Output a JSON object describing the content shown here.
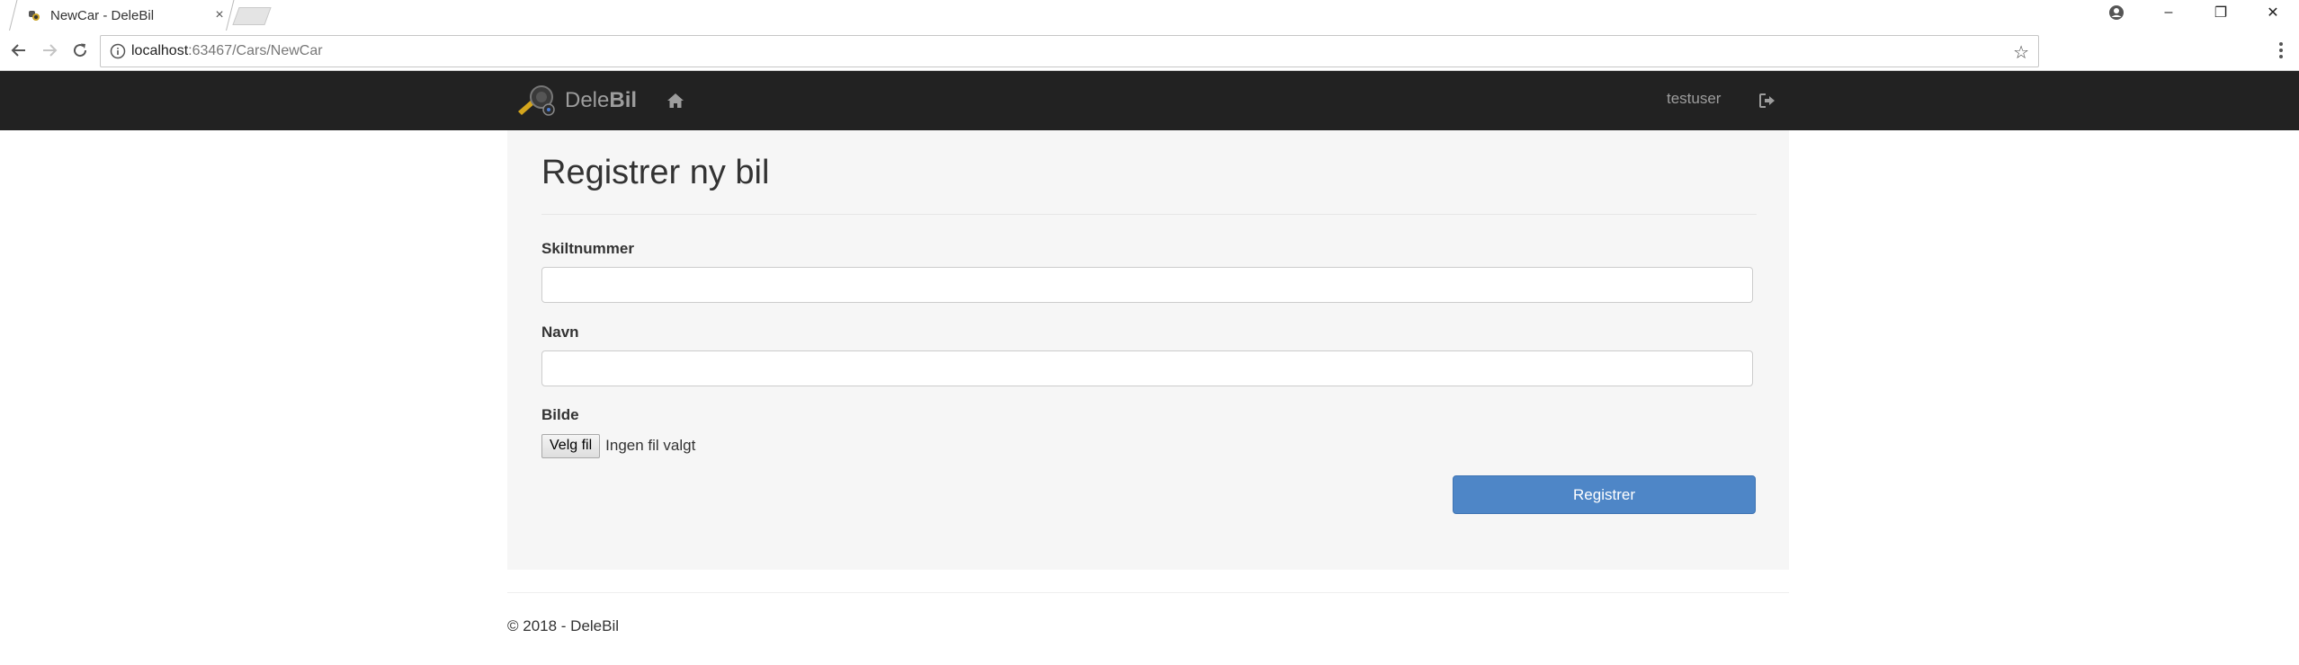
{
  "browser": {
    "tab_title": "NewCar - DeleBil",
    "tab_close": "×",
    "url_host": "localhost",
    "url_path": ":63467/Cars/NewCar",
    "bookmark_star": "☆",
    "window_minimize": "–",
    "window_restore": "❐",
    "window_close": "✕"
  },
  "navbar": {
    "brand_prefix": "Dele",
    "brand_bold": "Bil",
    "username": "testuser"
  },
  "form": {
    "title": "Registrer ny bil",
    "plate_label": "Skiltnummer",
    "plate_value": "",
    "name_label": "Navn",
    "name_value": "",
    "image_label": "Bilde",
    "file_button": "Velg fil",
    "file_status": "Ingen fil valgt",
    "submit_label": "Registrer"
  },
  "footer": {
    "text": "© 2018 - DeleBil"
  },
  "colors": {
    "navbar_bg": "#222222",
    "panel_bg": "#f6f6f6",
    "primary_button": "#4e86c7",
    "nav_text": "#9d9d9d"
  }
}
